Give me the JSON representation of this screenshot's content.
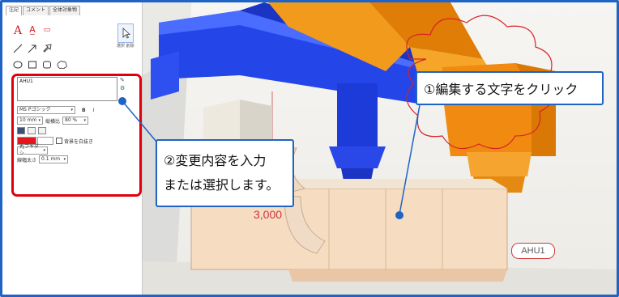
{
  "panel": {
    "tabs": [
      "注記",
      "コメント",
      "全体対象物"
    ],
    "select_label": "選択 削除",
    "text_value": "AHU1",
    "font_name": "MS Pゴシック",
    "bold_label": "B",
    "italic_label": "I",
    "size_value": "10 mm",
    "scale_label": "縦横比",
    "scale_value": "80 %",
    "frame_checkbox_label": "背景を白抜き",
    "shape_value": "丸フキダシ",
    "line_label": "線幅太さ",
    "line_value": "0.1 mm"
  },
  "view": {
    "dimension_label": "3,000",
    "equipment_tag": "AHU1"
  },
  "callouts": {
    "click_text": "①編集する文字をクリック",
    "input_line1": "②変更内容を入力",
    "input_line2": "または選択します。"
  },
  "colors": {
    "accent_blue": "#1f63c4",
    "highlight_red": "#e0000d",
    "duct_blue": "#1a3fe0",
    "duct_orange": "#f08a10",
    "cloud_red": "#d8222a"
  }
}
